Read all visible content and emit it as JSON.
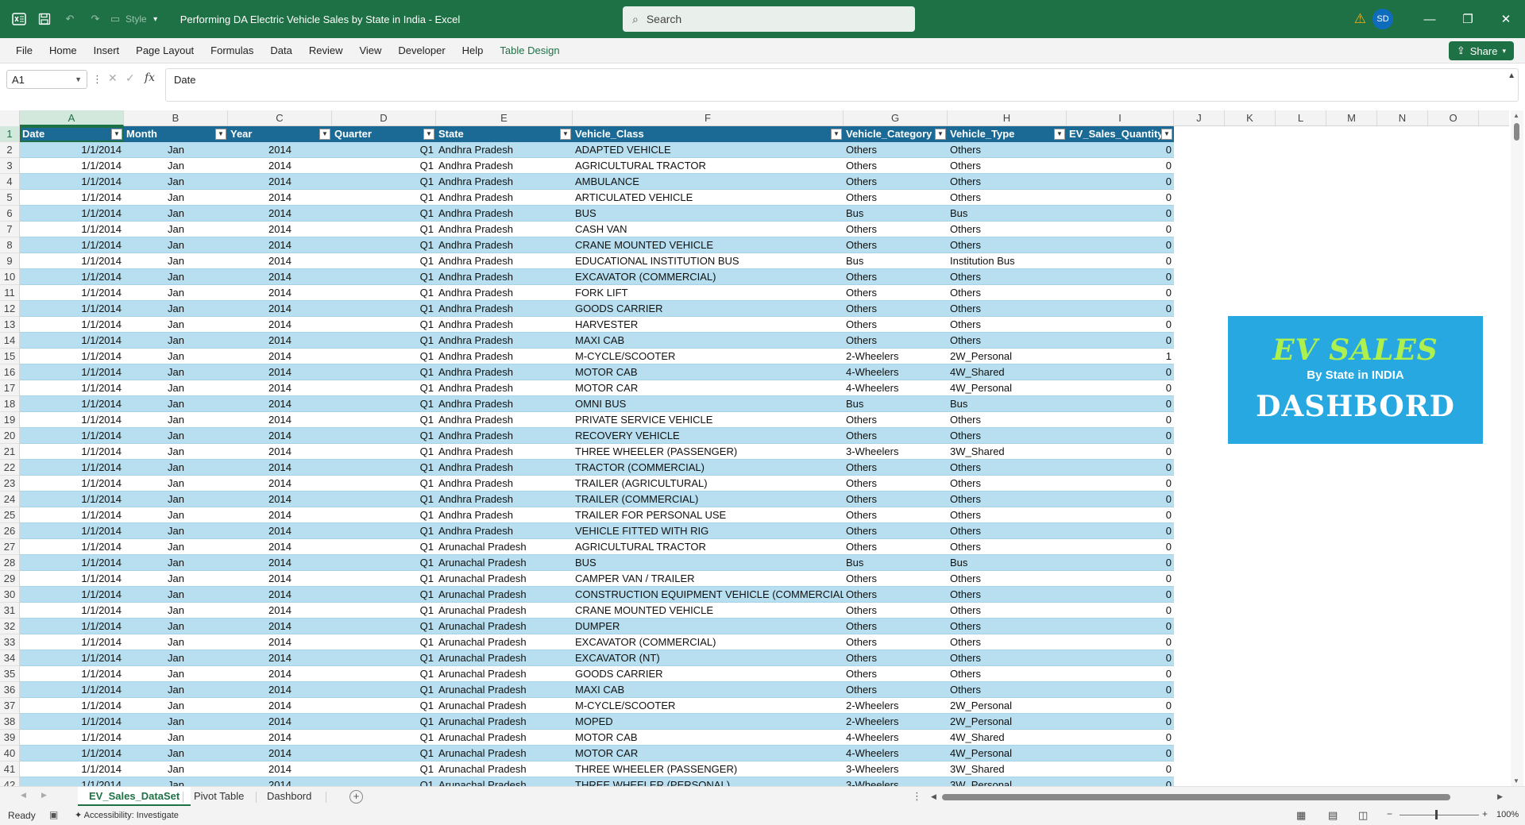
{
  "app": {
    "title": "Performing DA Electric Vehicle Sales by State in India  -  Excel",
    "style_label": "Style",
    "search_placeholder": "Search",
    "user_initials": "SD"
  },
  "menu": {
    "items": [
      "File",
      "Home",
      "Insert",
      "Page Layout",
      "Formulas",
      "Data",
      "Review",
      "View",
      "Developer",
      "Help",
      "Table Design"
    ],
    "share_label": "Share"
  },
  "formula_bar": {
    "name_box": "A1",
    "fx": "fx",
    "value": "Date"
  },
  "columns": [
    "A",
    "B",
    "C",
    "D",
    "E",
    "F",
    "G",
    "H",
    "I",
    "J",
    "K",
    "L",
    "M",
    "N",
    "O"
  ],
  "table": {
    "headers": [
      "Date",
      "Month",
      "Year",
      "Quarter",
      "State",
      "Vehicle_Class",
      "Vehicle_Category",
      "Vehicle_Type",
      "EV_Sales_Quantity"
    ],
    "rows": [
      [
        "1/1/2014",
        "Jan",
        "2014",
        "Q1",
        "Andhra Pradesh",
        "ADAPTED VEHICLE",
        "Others",
        "Others",
        "0"
      ],
      [
        "1/1/2014",
        "Jan",
        "2014",
        "Q1",
        "Andhra Pradesh",
        "AGRICULTURAL TRACTOR",
        "Others",
        "Others",
        "0"
      ],
      [
        "1/1/2014",
        "Jan",
        "2014",
        "Q1",
        "Andhra Pradesh",
        "AMBULANCE",
        "Others",
        "Others",
        "0"
      ],
      [
        "1/1/2014",
        "Jan",
        "2014",
        "Q1",
        "Andhra Pradesh",
        "ARTICULATED VEHICLE",
        "Others",
        "Others",
        "0"
      ],
      [
        "1/1/2014",
        "Jan",
        "2014",
        "Q1",
        "Andhra Pradesh",
        "BUS",
        "Bus",
        "Bus",
        "0"
      ],
      [
        "1/1/2014",
        "Jan",
        "2014",
        "Q1",
        "Andhra Pradesh",
        "CASH VAN",
        "Others",
        "Others",
        "0"
      ],
      [
        "1/1/2014",
        "Jan",
        "2014",
        "Q1",
        "Andhra Pradesh",
        "CRANE MOUNTED VEHICLE",
        "Others",
        "Others",
        "0"
      ],
      [
        "1/1/2014",
        "Jan",
        "2014",
        "Q1",
        "Andhra Pradesh",
        "EDUCATIONAL INSTITUTION BUS",
        "Bus",
        "Institution Bus",
        "0"
      ],
      [
        "1/1/2014",
        "Jan",
        "2014",
        "Q1",
        "Andhra Pradesh",
        "EXCAVATOR (COMMERCIAL)",
        "Others",
        "Others",
        "0"
      ],
      [
        "1/1/2014",
        "Jan",
        "2014",
        "Q1",
        "Andhra Pradesh",
        "FORK LIFT",
        "Others",
        "Others",
        "0"
      ],
      [
        "1/1/2014",
        "Jan",
        "2014",
        "Q1",
        "Andhra Pradesh",
        "GOODS CARRIER",
        "Others",
        "Others",
        "0"
      ],
      [
        "1/1/2014",
        "Jan",
        "2014",
        "Q1",
        "Andhra Pradesh",
        "HARVESTER",
        "Others",
        "Others",
        "0"
      ],
      [
        "1/1/2014",
        "Jan",
        "2014",
        "Q1",
        "Andhra Pradesh",
        "MAXI CAB",
        "Others",
        "Others",
        "0"
      ],
      [
        "1/1/2014",
        "Jan",
        "2014",
        "Q1",
        "Andhra Pradesh",
        "M-CYCLE/SCOOTER",
        "2-Wheelers",
        "2W_Personal",
        "1"
      ],
      [
        "1/1/2014",
        "Jan",
        "2014",
        "Q1",
        "Andhra Pradesh",
        "MOTOR CAB",
        "4-Wheelers",
        "4W_Shared",
        "0"
      ],
      [
        "1/1/2014",
        "Jan",
        "2014",
        "Q1",
        "Andhra Pradesh",
        "MOTOR CAR",
        "4-Wheelers",
        "4W_Personal",
        "0"
      ],
      [
        "1/1/2014",
        "Jan",
        "2014",
        "Q1",
        "Andhra Pradesh",
        "OMNI BUS",
        "Bus",
        "Bus",
        "0"
      ],
      [
        "1/1/2014",
        "Jan",
        "2014",
        "Q1",
        "Andhra Pradesh",
        "PRIVATE SERVICE VEHICLE",
        "Others",
        "Others",
        "0"
      ],
      [
        "1/1/2014",
        "Jan",
        "2014",
        "Q1",
        "Andhra Pradesh",
        "RECOVERY VEHICLE",
        "Others",
        "Others",
        "0"
      ],
      [
        "1/1/2014",
        "Jan",
        "2014",
        "Q1",
        "Andhra Pradesh",
        "THREE WHEELER (PASSENGER)",
        "3-Wheelers",
        "3W_Shared",
        "0"
      ],
      [
        "1/1/2014",
        "Jan",
        "2014",
        "Q1",
        "Andhra Pradesh",
        "TRACTOR (COMMERCIAL)",
        "Others",
        "Others",
        "0"
      ],
      [
        "1/1/2014",
        "Jan",
        "2014",
        "Q1",
        "Andhra Pradesh",
        "TRAILER (AGRICULTURAL)",
        "Others",
        "Others",
        "0"
      ],
      [
        "1/1/2014",
        "Jan",
        "2014",
        "Q1",
        "Andhra Pradesh",
        "TRAILER (COMMERCIAL)",
        "Others",
        "Others",
        "0"
      ],
      [
        "1/1/2014",
        "Jan",
        "2014",
        "Q1",
        "Andhra Pradesh",
        "TRAILER FOR PERSONAL USE",
        "Others",
        "Others",
        "0"
      ],
      [
        "1/1/2014",
        "Jan",
        "2014",
        "Q1",
        "Andhra Pradesh",
        "VEHICLE FITTED WITH RIG",
        "Others",
        "Others",
        "0"
      ],
      [
        "1/1/2014",
        "Jan",
        "2014",
        "Q1",
        "Arunachal Pradesh",
        "AGRICULTURAL TRACTOR",
        "Others",
        "Others",
        "0"
      ],
      [
        "1/1/2014",
        "Jan",
        "2014",
        "Q1",
        "Arunachal Pradesh",
        "BUS",
        "Bus",
        "Bus",
        "0"
      ],
      [
        "1/1/2014",
        "Jan",
        "2014",
        "Q1",
        "Arunachal Pradesh",
        "CAMPER VAN / TRAILER",
        "Others",
        "Others",
        "0"
      ],
      [
        "1/1/2014",
        "Jan",
        "2014",
        "Q1",
        "Arunachal Pradesh",
        "CONSTRUCTION EQUIPMENT VEHICLE (COMMERCIAL)",
        "Others",
        "Others",
        "0"
      ],
      [
        "1/1/2014",
        "Jan",
        "2014",
        "Q1",
        "Arunachal Pradesh",
        "CRANE MOUNTED VEHICLE",
        "Others",
        "Others",
        "0"
      ],
      [
        "1/1/2014",
        "Jan",
        "2014",
        "Q1",
        "Arunachal Pradesh",
        "DUMPER",
        "Others",
        "Others",
        "0"
      ],
      [
        "1/1/2014",
        "Jan",
        "2014",
        "Q1",
        "Arunachal Pradesh",
        "EXCAVATOR (COMMERCIAL)",
        "Others",
        "Others",
        "0"
      ],
      [
        "1/1/2014",
        "Jan",
        "2014",
        "Q1",
        "Arunachal Pradesh",
        "EXCAVATOR (NT)",
        "Others",
        "Others",
        "0"
      ],
      [
        "1/1/2014",
        "Jan",
        "2014",
        "Q1",
        "Arunachal Pradesh",
        "GOODS CARRIER",
        "Others",
        "Others",
        "0"
      ],
      [
        "1/1/2014",
        "Jan",
        "2014",
        "Q1",
        "Arunachal Pradesh",
        "MAXI CAB",
        "Others",
        "Others",
        "0"
      ],
      [
        "1/1/2014",
        "Jan",
        "2014",
        "Q1",
        "Arunachal Pradesh",
        "M-CYCLE/SCOOTER",
        "2-Wheelers",
        "2W_Personal",
        "0"
      ],
      [
        "1/1/2014",
        "Jan",
        "2014",
        "Q1",
        "Arunachal Pradesh",
        "MOPED",
        "2-Wheelers",
        "2W_Personal",
        "0"
      ],
      [
        "1/1/2014",
        "Jan",
        "2014",
        "Q1",
        "Arunachal Pradesh",
        "MOTOR CAB",
        "4-Wheelers",
        "4W_Shared",
        "0"
      ],
      [
        "1/1/2014",
        "Jan",
        "2014",
        "Q1",
        "Arunachal Pradesh",
        "MOTOR CAR",
        "4-Wheelers",
        "4W_Personal",
        "0"
      ],
      [
        "1/1/2014",
        "Jan",
        "2014",
        "Q1",
        "Arunachal Pradesh",
        "THREE WHEELER (PASSENGER)",
        "3-Wheelers",
        "3W_Shared",
        "0"
      ],
      [
        "1/1/2014",
        "Jan",
        "2014",
        "Q1",
        "Arunachal Pradesh",
        "THREE WHEELER (PERSONAL)",
        "3-Wheelers",
        "3W_Personal",
        "0"
      ]
    ]
  },
  "dashboard": {
    "title": "EV SALES",
    "subtitle": "By State in INDIA",
    "main": "DASHBORD"
  },
  "sheets": {
    "tabs": [
      "EV_Sales_DataSet",
      "Pivot Table",
      "Dashbord"
    ],
    "active": "EV_Sales_DataSet"
  },
  "status": {
    "ready": "Ready",
    "accessibility": "Accessibility: Investigate",
    "zoom": "100%"
  },
  "colors": {
    "excel_green": "#1e7145",
    "table_header": "#1b6a95",
    "band": "#b7dff0",
    "dashboard_bg": "#27a8e0",
    "dashboard_title": "#aef04e"
  }
}
